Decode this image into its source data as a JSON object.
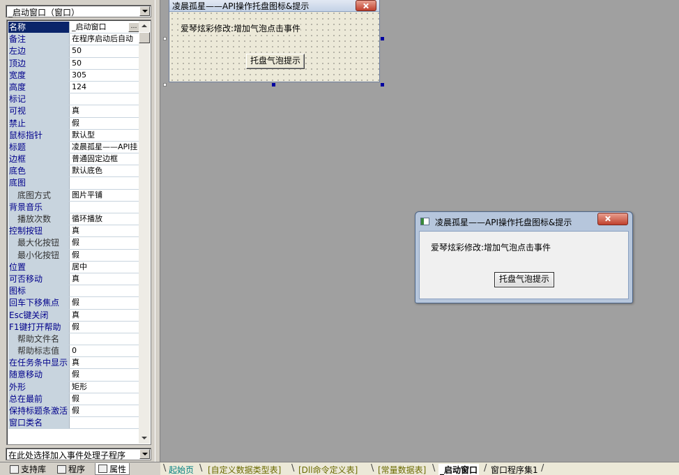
{
  "left_panel": {
    "object_selector": "_启动窗口（窗口）",
    "properties": [
      {
        "name": "名称",
        "value": "_启动窗口",
        "selected": true,
        "has_button": true
      },
      {
        "name": "备注",
        "value": "在程序启动后自动"
      },
      {
        "name": "左边",
        "value": "50"
      },
      {
        "name": "顶边",
        "value": "50"
      },
      {
        "name": "宽度",
        "value": "305"
      },
      {
        "name": "高度",
        "value": "124"
      },
      {
        "name": "标记",
        "value": ""
      },
      {
        "name": "可视",
        "value": "真"
      },
      {
        "name": "禁止",
        "value": "假"
      },
      {
        "name": "鼠标指针",
        "value": "默认型"
      },
      {
        "name": "标题",
        "value": "凌晨孤星——API挂"
      },
      {
        "name": "边框",
        "value": "普通固定边框"
      },
      {
        "name": "底色",
        "value": "默认底色"
      },
      {
        "name": "底图",
        "value": ""
      },
      {
        "name": "底图方式",
        "value": "图片平铺",
        "indent": true
      },
      {
        "name": "背景音乐",
        "value": ""
      },
      {
        "name": "播放次数",
        "value": "循环播放",
        "indent": true
      },
      {
        "name": "控制按钮",
        "value": "真"
      },
      {
        "name": "最大化按钮",
        "value": "假",
        "indent": true
      },
      {
        "name": "最小化按钮",
        "value": "假",
        "indent": true
      },
      {
        "name": "位置",
        "value": "居中"
      },
      {
        "name": "可否移动",
        "value": "真"
      },
      {
        "name": "图标",
        "value": ""
      },
      {
        "name": "回车下移焦点",
        "value": "假"
      },
      {
        "name": "Esc键关闭",
        "value": "真"
      },
      {
        "name": "F1键打开帮助",
        "value": "假"
      },
      {
        "name": "帮助文件名",
        "value": "",
        "indent": true
      },
      {
        "name": "帮助标志值",
        "value": "0",
        "indent": true
      },
      {
        "name": "在任务条中显示",
        "value": "真"
      },
      {
        "name": "随意移动",
        "value": "假"
      },
      {
        "name": "外形",
        "value": "矩形"
      },
      {
        "name": "总在最前",
        "value": "假"
      },
      {
        "name": "保持标题条激活",
        "value": "假"
      },
      {
        "name": "窗口类名",
        "value": ""
      }
    ],
    "event_selector": "在此处选择加入事件处理子程序",
    "ellipsis": "…",
    "tabs": [
      "支持库",
      "程序",
      "属性"
    ]
  },
  "design_form": {
    "title": "凌晨孤星——API操作托盘图标&提示",
    "label": "爱琴炫彩修改:增加气泡点击事件",
    "button": "托盘气泡提示"
  },
  "preview_window": {
    "title": "凌晨孤星——API操作托盘图标&提示",
    "label": "爱琴炫彩修改:增加气泡点击事件",
    "button": "托盘气泡提示"
  },
  "editor_tabs": [
    "起始页",
    "[自定义数据类型表]",
    "[Dll命令定义表]",
    "[常量数据表]",
    "_启动窗口",
    "窗口程序集1"
  ],
  "editor_tabs_active": "_启动窗口"
}
